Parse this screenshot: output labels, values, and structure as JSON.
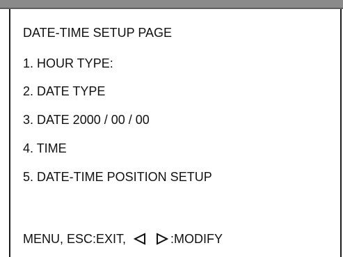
{
  "menu": {
    "title": "DATE-TIME SETUP PAGE",
    "items": [
      "1. HOUR TYPE:",
      "2. DATE TYPE",
      "3. DATE 2000 / 00 / 00",
      "4. TIME",
      "5. DATE-TIME POSITION SETUP"
    ]
  },
  "footer": {
    "exit_label": "MENU, ESC:EXIT,",
    "modify_label": ":MODIFY",
    "left_icon": "triangle-left-icon",
    "right_icon": "triangle-right-icon"
  }
}
